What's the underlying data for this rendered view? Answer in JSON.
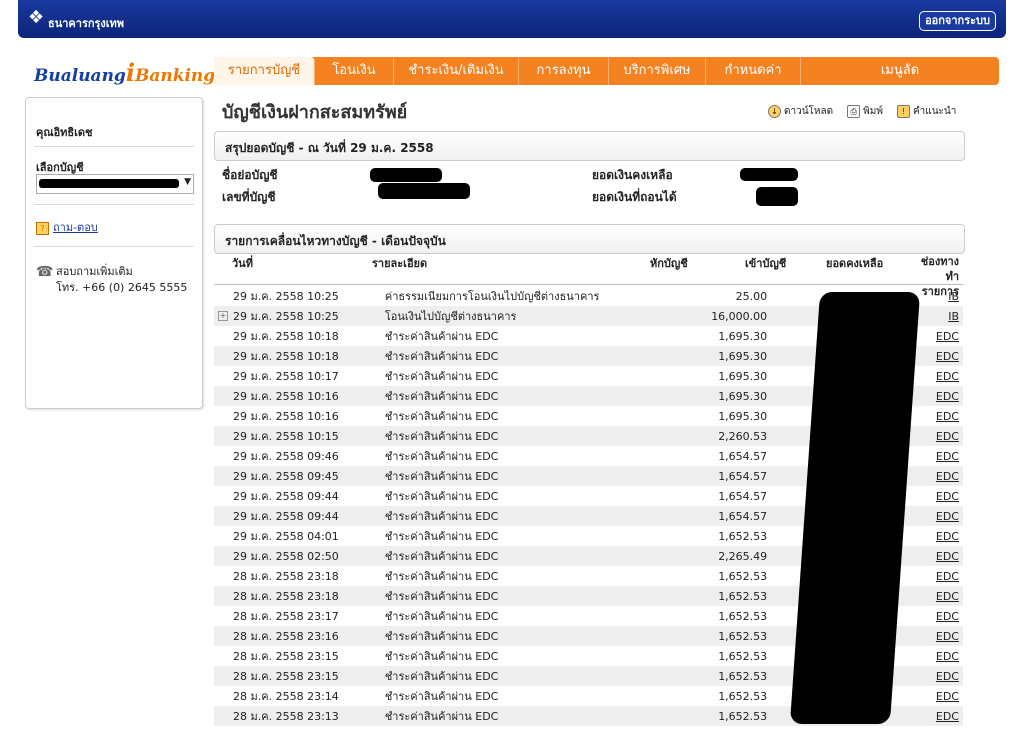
{
  "header": {
    "bank_name": "ธนาคารกรุงเทพ",
    "logout_label": "ออกจากระบบ"
  },
  "logo": {
    "part1": "Bualuang",
    "part2": "i",
    "part3": "Banking"
  },
  "nav": {
    "tabs": [
      "รายการบัญชี",
      "โอนเงิน",
      "ชำระเงิน/เติมเงิน",
      "การลงทุน",
      "บริการพิเศษ",
      "กำหนดค่า",
      "เมนูลัด"
    ]
  },
  "sidebar": {
    "user_name": "คุณอิทธิเดช",
    "select_label": "เลือกบัญชี",
    "qa_label": "ถาม-ตอบ",
    "contact_line1": "สอบถามเพิ่มเติม",
    "contact_line2": "โทร. +66 (0) 2645 5555"
  },
  "page": {
    "title": "บัญชีเงินฝากสะสมทรัพย์"
  },
  "tools": {
    "download": "ดาวน์โหลด",
    "print": "พิมพ์",
    "help": "คำแนะนำ"
  },
  "summary": {
    "heading": "สรุปยอดบัญชี - ณ วันที่ 29 ม.ค. 2558",
    "nickname_label": "ชื่อย่อบัญชี",
    "account_no_label": "เลขที่บัญชี",
    "balance_label": "ยอดเงินคงเหลือ",
    "available_label": "ยอดเงินที่ถอนได้"
  },
  "movements": {
    "heading": "รายการเคลื่อนไหวทางบัญชี - เดือนปัจจุบัน",
    "col_date": "วันที่",
    "col_desc": "รายละเอียด",
    "col_debit": "หักบัญชี",
    "col_credit": "เข้าบัญชี",
    "col_balance": "ยอดคงเหลือ",
    "col_channel_1": "ช่องทาง",
    "col_channel_2": "ทำรายการ"
  },
  "transactions": [
    {
      "date": "29 ม.ค. 2558 10:25",
      "desc": "ค่าธรรมเนียมการโอนเงินไปบัญชีต่างธนาคาร",
      "debit": "25.00",
      "balance": "",
      "channel": "IB"
    },
    {
      "date": "29 ม.ค. 2558 10:25",
      "desc": "โอนเงินไปบัญชีต่างธนาคาร",
      "debit": "16,000.00",
      "balance": "",
      "channel": "IB"
    },
    {
      "date": "29 ม.ค. 2558 10:18",
      "desc": "ชำระค่าสินค้าผ่าน EDC",
      "debit": "1,695.30",
      "balance": "",
      "channel": "EDC"
    },
    {
      "date": "29 ม.ค. 2558 10:18",
      "desc": "ชำระค่าสินค้าผ่าน EDC",
      "debit": "1,695.30",
      "balance": "",
      "channel": "EDC"
    },
    {
      "date": "29 ม.ค. 2558 10:17",
      "desc": "ชำระค่าสินค้าผ่าน EDC",
      "debit": "1,695.30",
      "balance": "",
      "channel": "EDC"
    },
    {
      "date": "29 ม.ค. 2558 10:16",
      "desc": "ชำระค่าสินค้าผ่าน EDC",
      "debit": "1,695.30",
      "balance": "",
      "channel": "EDC"
    },
    {
      "date": "29 ม.ค. 2558 10:16",
      "desc": "ชำระค่าสินค้าผ่าน EDC",
      "debit": "1,695.30",
      "balance": "",
      "channel": "EDC"
    },
    {
      "date": "29 ม.ค. 2558 10:15",
      "desc": "ชำระค่าสินค้าผ่าน EDC",
      "debit": "2,260.53",
      "balance": "",
      "channel": "EDC"
    },
    {
      "date": "29 ม.ค. 2558 09:46",
      "desc": "ชำระค่าสินค้าผ่าน EDC",
      "debit": "1,654.57",
      "balance": "",
      "channel": "EDC"
    },
    {
      "date": "29 ม.ค. 2558 09:45",
      "desc": "ชำระค่าสินค้าผ่าน EDC",
      "debit": "1,654.57",
      "balance": "",
      "channel": "EDC"
    },
    {
      "date": "29 ม.ค. 2558 09:44",
      "desc": "ชำระค่าสินค้าผ่าน EDC",
      "debit": "1,654.57",
      "balance": "",
      "channel": "EDC"
    },
    {
      "date": "29 ม.ค. 2558 09:44",
      "desc": "ชำระค่าสินค้าผ่าน EDC",
      "debit": "1,654.57",
      "balance": "",
      "channel": "EDC"
    },
    {
      "date": "29 ม.ค. 2558 04:01",
      "desc": "ชำระค่าสินค้าผ่าน EDC",
      "debit": "1,652.53",
      "balance": "",
      "channel": "EDC"
    },
    {
      "date": "29 ม.ค. 2558 02:50",
      "desc": "ชำระค่าสินค้าผ่าน EDC",
      "debit": "2,265.49",
      "balance": "",
      "channel": "EDC"
    },
    {
      "date": "28 ม.ค. 2558 23:18",
      "desc": "ชำระค่าสินค้าผ่าน EDC",
      "debit": "1,652.53",
      "balance": "",
      "channel": "EDC"
    },
    {
      "date": "28 ม.ค. 2558 23:18",
      "desc": "ชำระค่าสินค้าผ่าน EDC",
      "debit": "1,652.53",
      "balance": "",
      "channel": "EDC"
    },
    {
      "date": "28 ม.ค. 2558 23:17",
      "desc": "ชำระค่าสินค้าผ่าน EDC",
      "debit": "1,652.53",
      "balance": "",
      "channel": "EDC"
    },
    {
      "date": "28 ม.ค. 2558 23:16",
      "desc": "ชำระค่าสินค้าผ่าน EDC",
      "debit": "1,652.53",
      "balance": "",
      "channel": "EDC"
    },
    {
      "date": "28 ม.ค. 2558 23:15",
      "desc": "ชำระค่าสินค้าผ่าน EDC",
      "debit": "1,652.53",
      "balance": "",
      "channel": "EDC"
    },
    {
      "date": "28 ม.ค. 2558 23:15",
      "desc": "ชำระค่าสินค้าผ่าน EDC",
      "debit": "1,652.53",
      "balance": "",
      "channel": "EDC"
    },
    {
      "date": "28 ม.ค. 2558 23:14",
      "desc": "ชำระค่าสินค้าผ่าน EDC",
      "debit": "1,652.53",
      "balance": "",
      "channel": "EDC"
    },
    {
      "date": "28 ม.ค. 2558 23:13",
      "desc": "ชำระค่าสินค้าผ่าน EDC",
      "debit": "1,652.53",
      "balance": "",
      "channel": "EDC"
    }
  ],
  "colors": {
    "header_blue": "#0b2478",
    "nav_orange": "#f58220",
    "logo_blue": "#1240a8",
    "logo_orange": "#f07800"
  }
}
